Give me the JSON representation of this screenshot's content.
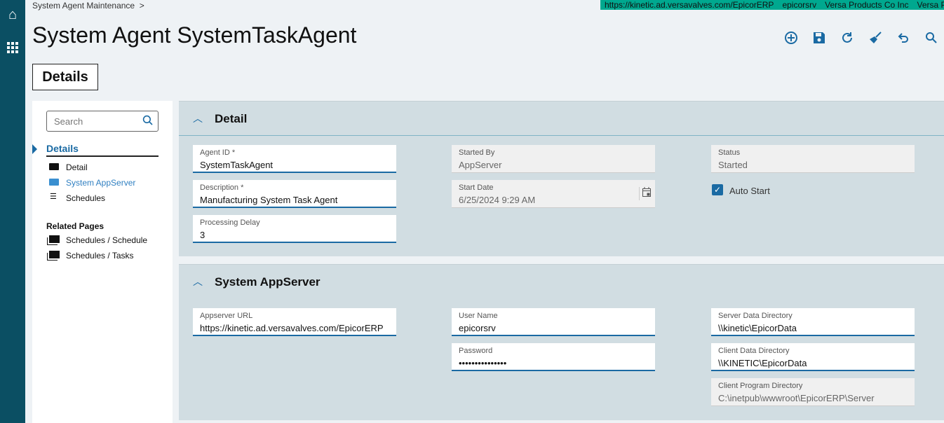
{
  "breadcrumb": {
    "label": "System Agent Maintenance",
    "separator": ">"
  },
  "env": {
    "url": "https://kinetic.ad.versavalves.com/EpicorERP",
    "user": "epicorsrv",
    "company": "Versa Products Co Inc",
    "site": "Versa Products"
  },
  "page": {
    "title": "System Agent SystemTaskAgent",
    "tab": "Details"
  },
  "toolbar": [
    "add-new",
    "save",
    "refresh",
    "clear",
    "undo",
    "search"
  ],
  "sidebar": {
    "search_placeholder": "Search",
    "group": "Details",
    "items": [
      {
        "label": "Detail"
      },
      {
        "label": "System AppServer"
      },
      {
        "label": "Schedules"
      }
    ],
    "related_title": "Related Pages",
    "related": [
      {
        "label": "Schedules / Schedule"
      },
      {
        "label": "Schedules / Tasks"
      }
    ]
  },
  "detail": {
    "title": "Detail",
    "agent_id": {
      "label": "Agent ID *",
      "value": "SystemTaskAgent"
    },
    "description": {
      "label": "Description *",
      "value": "Manufacturing System Task Agent"
    },
    "processing_delay": {
      "label": "Processing Delay",
      "value": "3"
    },
    "started_by": {
      "label": "Started By",
      "value": "AppServer"
    },
    "start_date": {
      "label": "Start Date",
      "value": "6/25/2024 9:29 AM"
    },
    "status": {
      "label": "Status",
      "value": "Started"
    },
    "auto_start": {
      "label": "Auto Start",
      "checked": true
    }
  },
  "appserver": {
    "title": "System AppServer",
    "url": {
      "label": "Appserver URL",
      "value": "https://kinetic.ad.versavalves.com/EpicorERP"
    },
    "user": {
      "label": "User Name",
      "value": "epicorsrv"
    },
    "password": {
      "label": "Password",
      "value": "•••••••••••••••"
    },
    "server_dir": {
      "label": "Server Data Directory",
      "value": "\\\\kinetic\\EpicorData"
    },
    "client_dir": {
      "label": "Client Data Directory",
      "value": "\\\\KINETIC\\EpicorData"
    },
    "program_dir": {
      "label": "Client Program Directory",
      "value": "C:\\inetpub\\wwwroot\\EpicorERP\\Server"
    }
  },
  "colors": {
    "rail": "#0b4f63",
    "accent": "#1a6aa3",
    "env": "#00a88f"
  }
}
